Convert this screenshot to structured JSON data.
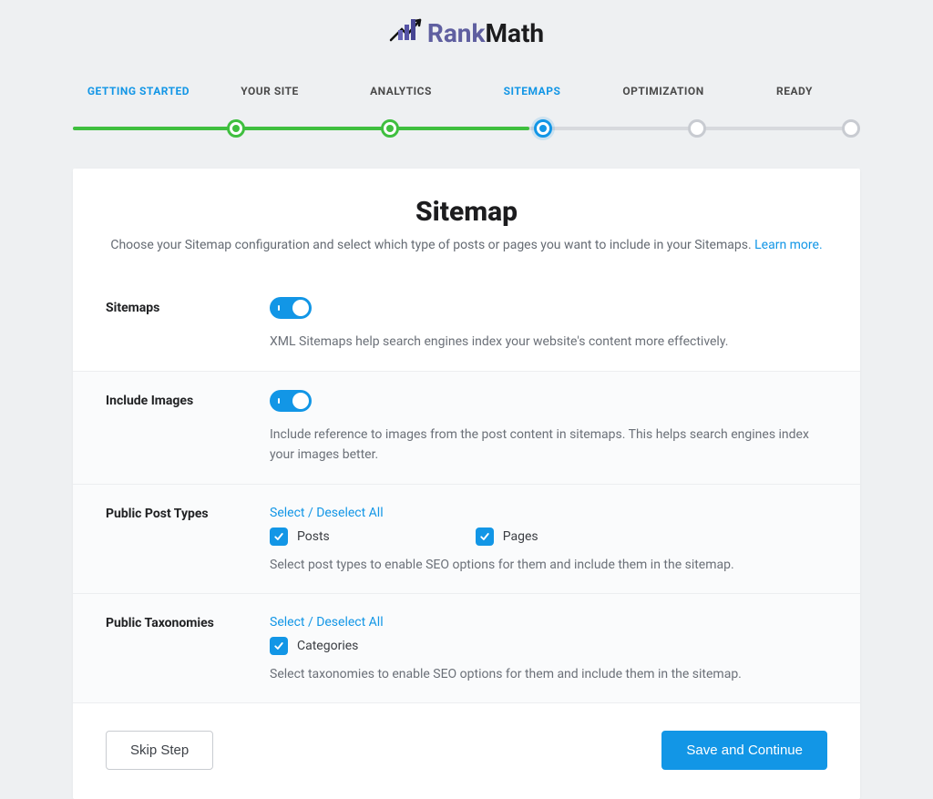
{
  "brand": {
    "part1": "Rank",
    "part2": "Math"
  },
  "steps": [
    {
      "label": "GETTING STARTED",
      "state": "done"
    },
    {
      "label": "YOUR SITE",
      "state": "done"
    },
    {
      "label": "ANALYTICS",
      "state": "done"
    },
    {
      "label": "SITEMAPS",
      "state": "current"
    },
    {
      "label": "OPTIMIZATION",
      "state": "future"
    },
    {
      "label": "READY",
      "state": "future"
    }
  ],
  "page": {
    "title": "Sitemap",
    "subtitle": "Choose your Sitemap configuration and select which type of posts or pages you want to include in your Sitemaps. ",
    "learn_more": "Learn more."
  },
  "sections": {
    "sitemaps": {
      "label": "Sitemaps",
      "state": true,
      "desc": "XML Sitemaps help search engines index your website's content more effectively."
    },
    "images": {
      "label": "Include Images",
      "state": true,
      "desc": "Include reference to images from the post content in sitemaps. This helps search engines index your images better."
    },
    "post_types": {
      "label": "Public Post Types",
      "select_all": "Select / Deselect All",
      "options": [
        {
          "label": "Posts",
          "checked": true
        },
        {
          "label": "Pages",
          "checked": true
        }
      ],
      "desc": "Select post types to enable SEO options for them and include them in the sitemap."
    },
    "taxonomies": {
      "label": "Public Taxonomies",
      "select_all": "Select / Deselect All",
      "options": [
        {
          "label": "Categories",
          "checked": true
        }
      ],
      "desc": "Select taxonomies to enable SEO options for them and include them in the sitemap."
    }
  },
  "footer": {
    "skip": "Skip Step",
    "continue": "Save and Continue"
  }
}
